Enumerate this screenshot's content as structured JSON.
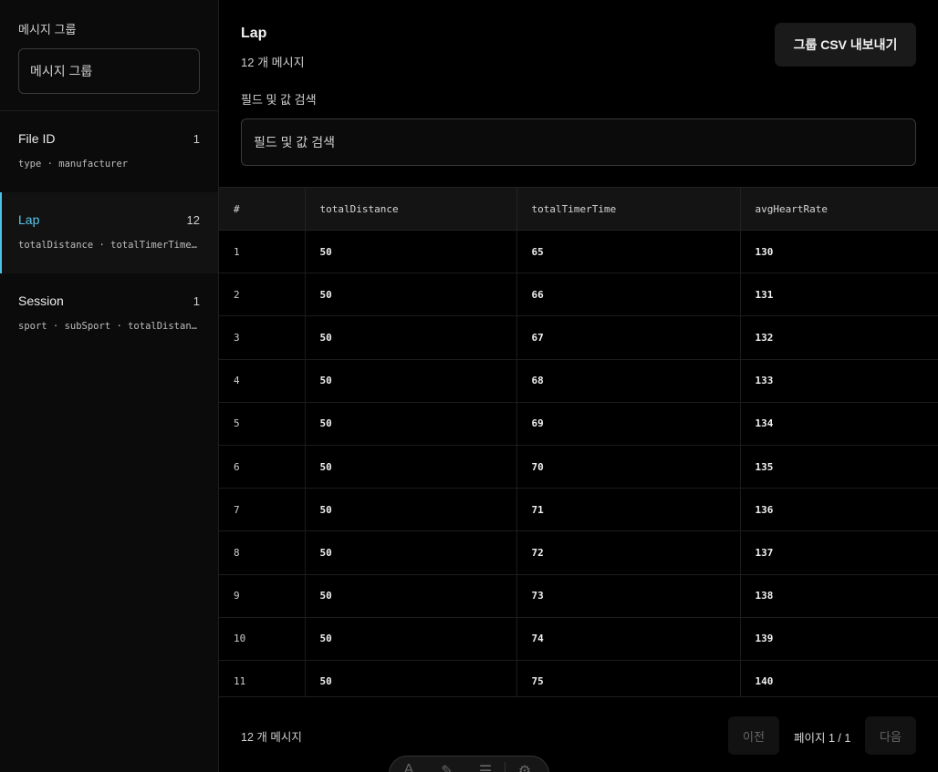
{
  "sidebar": {
    "label": "메시지 그룹",
    "input_placeholder": "메시지 그룹",
    "groups": [
      {
        "name": "File ID",
        "count": "1",
        "fields": "type · manufacturer"
      },
      {
        "name": "Lap",
        "count": "12",
        "fields": "totalDistance · totalTimerTime · avgHeartRate"
      },
      {
        "name": "Session",
        "count": "1",
        "fields": "sport · subSport · totalDistance · totalTimerTime"
      }
    ]
  },
  "header": {
    "title": "Lap",
    "subtitle": "12 개 메시지",
    "export_label": "그룹 CSV 내보내기",
    "search_label": "필드 및 값 검색",
    "search_placeholder": "필드 및 값 검색"
  },
  "table": {
    "columns": [
      "#",
      "totalDistance",
      "totalTimerTime",
      "avgHeartRate"
    ],
    "rows": [
      [
        "1",
        "50",
        "65",
        "130"
      ],
      [
        "2",
        "50",
        "66",
        "131"
      ],
      [
        "3",
        "50",
        "67",
        "132"
      ],
      [
        "4",
        "50",
        "68",
        "133"
      ],
      [
        "5",
        "50",
        "69",
        "134"
      ],
      [
        "6",
        "50",
        "70",
        "135"
      ],
      [
        "7",
        "50",
        "71",
        "136"
      ],
      [
        "8",
        "50",
        "72",
        "137"
      ],
      [
        "9",
        "50",
        "73",
        "138"
      ],
      [
        "10",
        "50",
        "74",
        "139"
      ],
      [
        "11",
        "50",
        "75",
        "140"
      ]
    ]
  },
  "footer": {
    "count": "12 개 메시지",
    "prev_label": "이전",
    "page_info": "페이지 1 / 1",
    "next_label": "다음"
  },
  "toolbar": {
    "icons": [
      "font-icon",
      "pen-icon",
      "menu-icon",
      "gear-icon"
    ]
  },
  "colors": {
    "accent": "#5ac8eb",
    "background": "#000000",
    "sidebar_bg": "#0b0b0b"
  }
}
